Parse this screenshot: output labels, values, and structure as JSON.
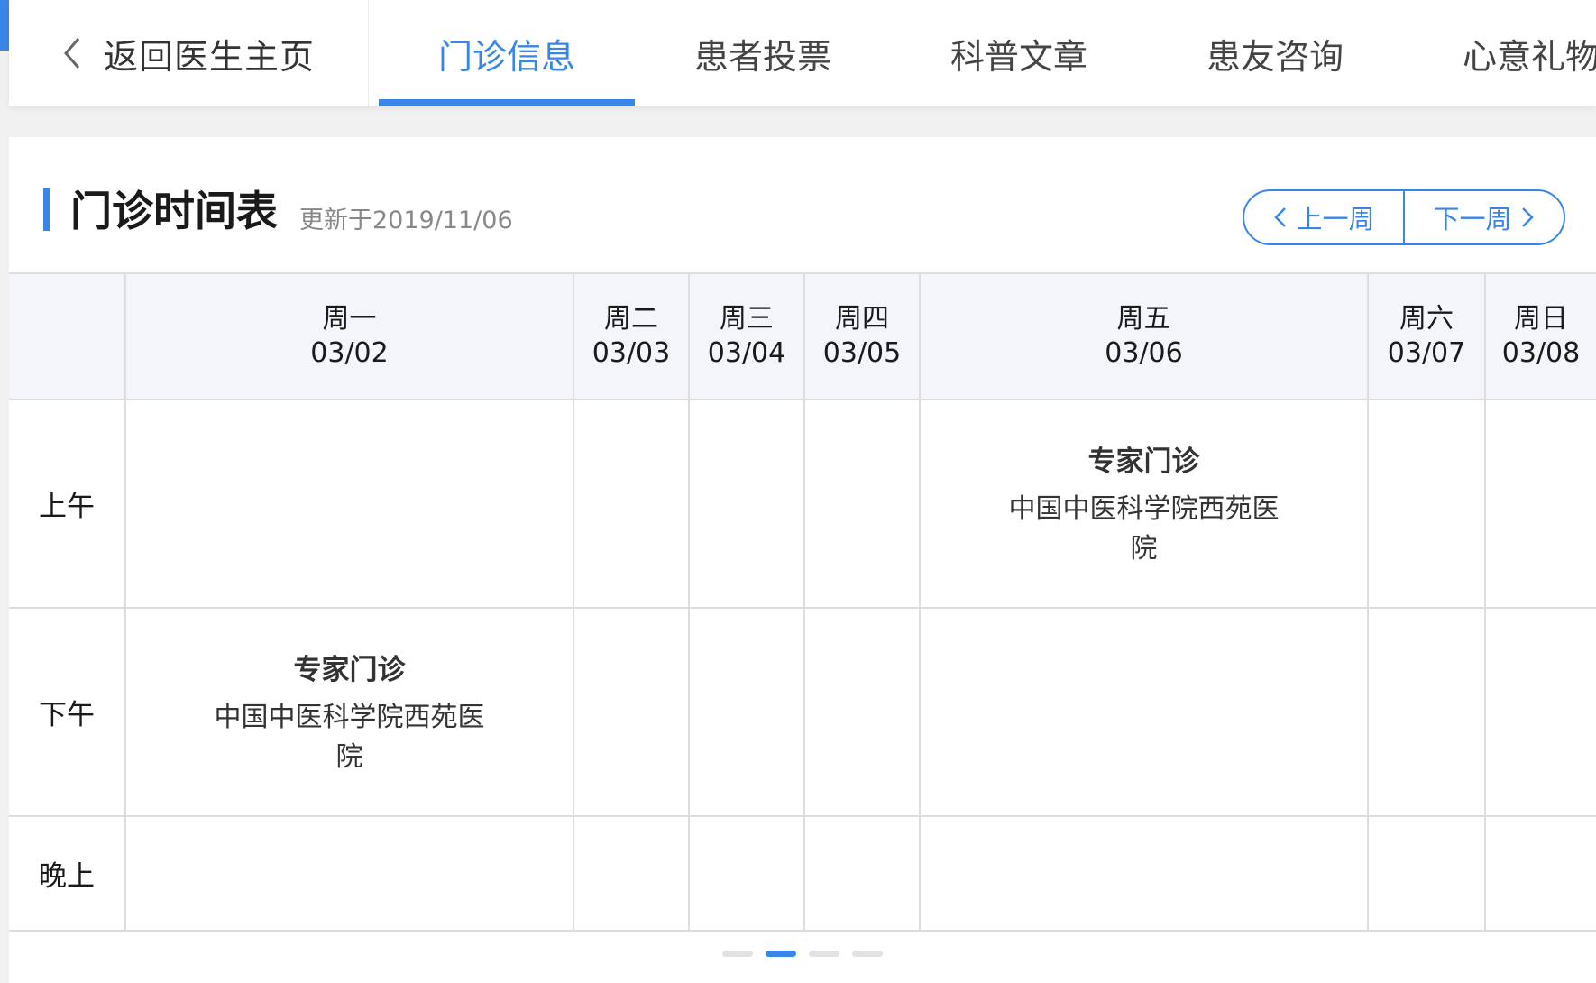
{
  "nav": {
    "back_label": "返回医生主页",
    "tabs": [
      {
        "label": "门诊信息",
        "active": true
      },
      {
        "label": "患者投票",
        "active": false
      },
      {
        "label": "科普文章",
        "active": false
      },
      {
        "label": "患友咨询",
        "active": false
      },
      {
        "label": "心意礼物",
        "active": false
      }
    ]
  },
  "schedule": {
    "title": "门诊时间表",
    "updated": "更新于2019/11/06",
    "prev_week_label": "上一周",
    "next_week_label": "下一周",
    "days": [
      {
        "name": "周一",
        "date": "03/02"
      },
      {
        "name": "周二",
        "date": "03/03"
      },
      {
        "name": "周三",
        "date": "03/04"
      },
      {
        "name": "周四",
        "date": "03/05"
      },
      {
        "name": "周五",
        "date": "03/06"
      },
      {
        "name": "周六",
        "date": "03/07"
      },
      {
        "name": "周日",
        "date": "03/08"
      }
    ],
    "slots": [
      {
        "label": "上午"
      },
      {
        "label": "下午"
      },
      {
        "label": "晚上"
      }
    ],
    "entries": {
      "fri_am": {
        "type": "专家门诊",
        "hospital": "中国中医科学院西苑医院"
      },
      "mon_pm": {
        "type": "专家门诊",
        "hospital": "中国中医科学院西苑医院"
      }
    }
  },
  "pagination": {
    "count": 4,
    "active_index": 1
  },
  "colors": {
    "accent": "#3a86e8",
    "header_bg": "#f3f5fa",
    "border": "#dddddd"
  }
}
